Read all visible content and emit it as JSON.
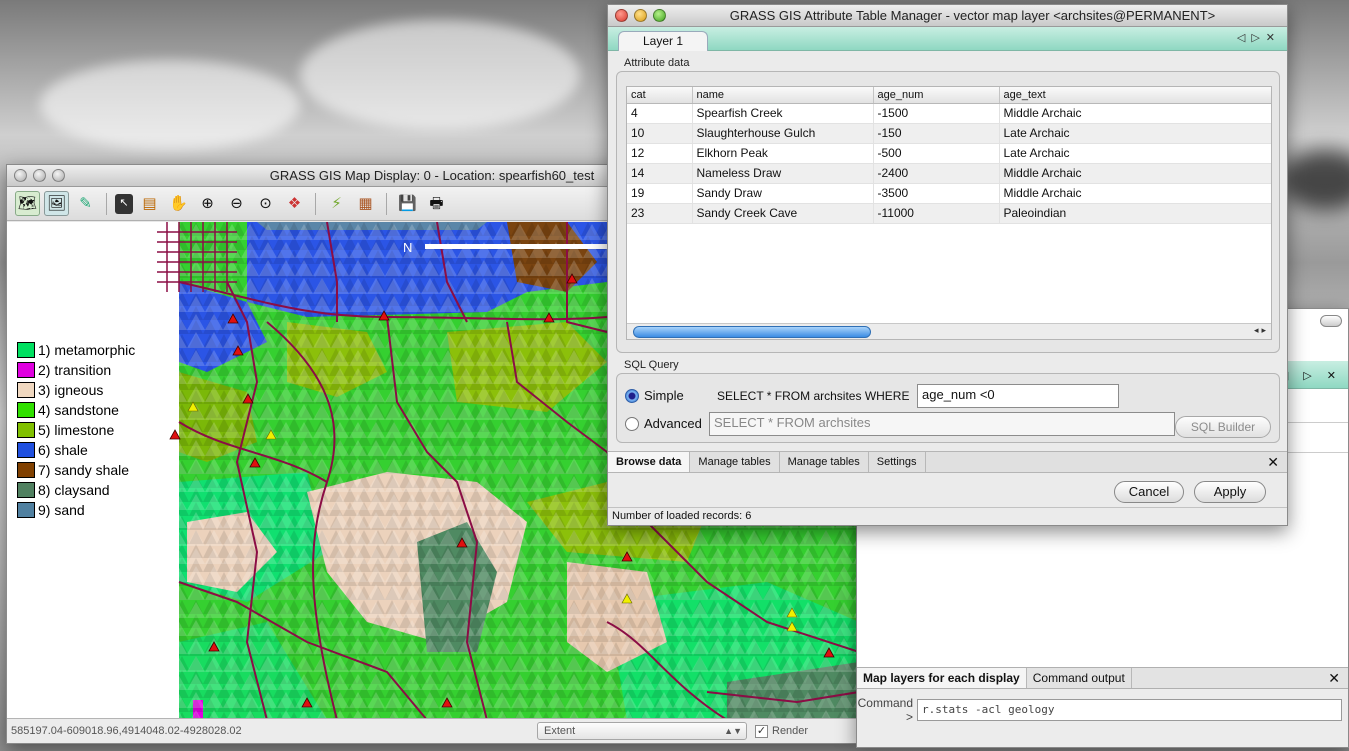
{
  "map_display": {
    "title": "GRASS GIS Map Display: 0 - Location: spearfish60_test",
    "toolbar_icons": [
      "display-icon",
      "render-icon",
      "erase-icon",
      "pointer-icon",
      "query-icon",
      "pan-icon",
      "zoom-in-icon",
      "zoom-out-icon",
      "zoom-back-icon",
      "zoom-menu-icon",
      "analyze-icon",
      "overlay-icon",
      "save-icon",
      "print-icon"
    ],
    "north_arrow": "N",
    "legend": [
      {
        "label": "1) metamorphic",
        "color": "#00e060"
      },
      {
        "label": "2) transition",
        "color": "#e000e0"
      },
      {
        "label": "3) igneous",
        "color": "#f0d8c0"
      },
      {
        "label": "4) sandstone",
        "color": "#30e000"
      },
      {
        "label": "5) limestone",
        "color": "#80c000"
      },
      {
        "label": "6) shale",
        "color": "#2050e0"
      },
      {
        "label": "7) sandy shale",
        "color": "#804000"
      },
      {
        "label": "8) claysand",
        "color": "#508060"
      },
      {
        "label": "9) sand",
        "color": "#5080a0"
      }
    ],
    "status": {
      "coordinates": "585197.04-609018.96,4914048.02-4928028.02",
      "extent_selected": "Extent",
      "render_label": "Render",
      "render_checked": "✓"
    }
  },
  "attribute_manager": {
    "title": "GRASS GIS Attribute Table Manager - vector map layer <archsites@PERMANENT>",
    "layer_tab": "Layer 1",
    "attribute_section": "Attribute data",
    "columns": [
      "cat",
      "name",
      "age_num",
      "age_text"
    ],
    "rows": [
      {
        "cat": "4",
        "name": "Spearfish Creek",
        "age_num": "-1500",
        "age_text": "Middle Archaic"
      },
      {
        "cat": "10",
        "name": "Slaughterhouse Gulch",
        "age_num": "-150",
        "age_text": "Late Archaic"
      },
      {
        "cat": "12",
        "name": "Elkhorn Peak",
        "age_num": "-500",
        "age_text": "Late Archaic"
      },
      {
        "cat": "14",
        "name": "Nameless Draw",
        "age_num": "-2400",
        "age_text": "Middle Archaic"
      },
      {
        "cat": "19",
        "name": "Sandy Draw",
        "age_num": "-3500",
        "age_text": "Middle Archaic"
      },
      {
        "cat": "23",
        "name": "Sandy Creek Cave",
        "age_num": "-11000",
        "age_text": "Paleoindian"
      }
    ],
    "sql_section": "SQL Query",
    "simple_label": "Simple",
    "simple_prefix": "SELECT * FROM archsites WHERE",
    "simple_value": "age_num <0",
    "advanced_label": "Advanced",
    "advanced_value": "SELECT * FROM archsites",
    "sql_builder_label": "SQL Builder",
    "tabs": [
      "Browse data",
      "Manage tables",
      "Manage tables",
      "Settings"
    ],
    "cancel_label": "Cancel",
    "apply_label": "Apply",
    "status": "Number of loaded records: 6"
  },
  "layer_manager": {
    "tabs": [
      "Map layers for each display",
      "Command output"
    ],
    "command_label": "Command >",
    "command_value": "r.stats -acl geology"
  }
}
